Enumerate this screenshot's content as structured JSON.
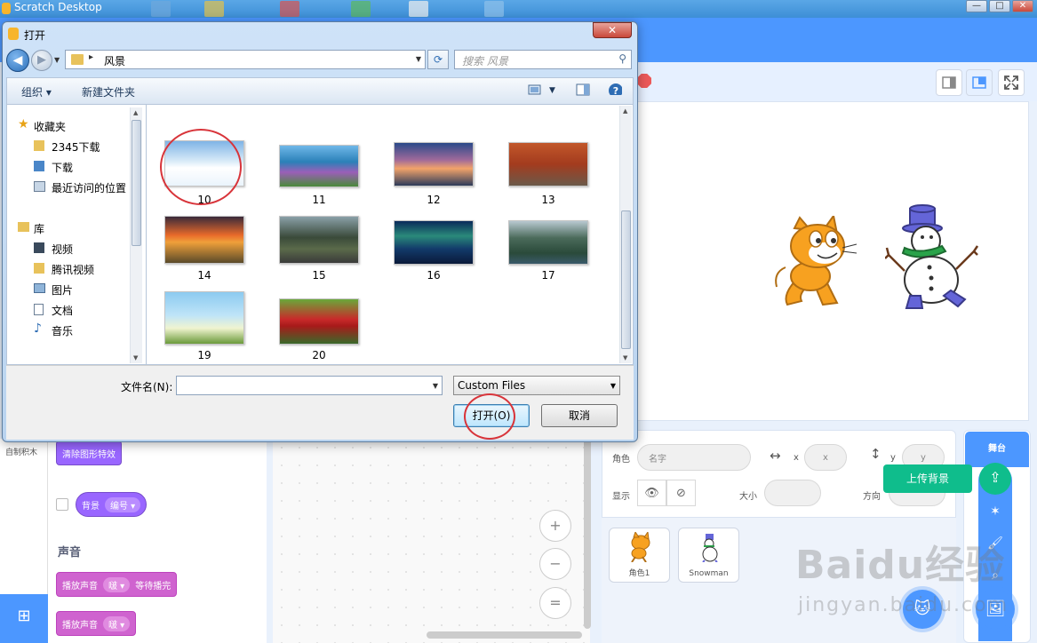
{
  "app": {
    "title": "Scratch Desktop",
    "window_buttons": [
      "—",
      "□",
      "✕"
    ]
  },
  "stage": {
    "mode_icons": [
      "small-stage-icon",
      "normal-stage-icon",
      "fullscreen-icon"
    ]
  },
  "sprite_info": {
    "sprite_label": "角色",
    "name_placeholder": "名字",
    "x_label": "x",
    "x_placeholder": "x",
    "y_label": "y",
    "y_placeholder": "y",
    "show_label": "显示",
    "size_label": "大小",
    "direction_label": "方向"
  },
  "sprites": [
    {
      "name": "角色1"
    },
    {
      "name": "Snowman"
    }
  ],
  "stage_panel": {
    "tab_label": "舞台",
    "upload_tooltip": "上传背景"
  },
  "code": {
    "category_partial": "自制积木",
    "block_clear_effects": "清除图形特效",
    "block_backdrop": "背景",
    "block_backdrop_dropdown": "编号",
    "section_sound": "声音",
    "block_play_until_done": "播放声音",
    "block_play_until_done_dropdown": "啵",
    "block_play_until_done_suffix": "等待播完",
    "block_play": "播放声音",
    "block_play_dropdown": "啵",
    "zoom_in": "+",
    "zoom_out": "−",
    "zoom_reset": "="
  },
  "dialog": {
    "title": "打开",
    "close": "✕",
    "address_path": "风景",
    "search_placeholder": "搜索 风景",
    "toolbar": {
      "organize": "组织 ▾",
      "new_folder": "新建文件夹"
    },
    "nav": {
      "favorites": "收藏夹",
      "fav_items": [
        "2345下载",
        "下载",
        "最近访问的位置"
      ],
      "libraries": "库",
      "lib_items": [
        "视频",
        "腾讯视频",
        "图片",
        "文档",
        "音乐"
      ]
    },
    "files": [
      {
        "name": "10"
      },
      {
        "name": "11"
      },
      {
        "name": "12"
      },
      {
        "name": "13"
      },
      {
        "name": "14"
      },
      {
        "name": "15"
      },
      {
        "name": "16"
      },
      {
        "name": "17"
      },
      {
        "name": "19"
      },
      {
        "name": "20"
      }
    ],
    "filename_label": "文件名(N):",
    "filename_value": "",
    "filetype": "Custom Files",
    "open_button": "打开(O)",
    "cancel_button": "取消"
  },
  "watermark": {
    "line1": "Baidu经验",
    "line2": "jingyan.baidu.com"
  }
}
